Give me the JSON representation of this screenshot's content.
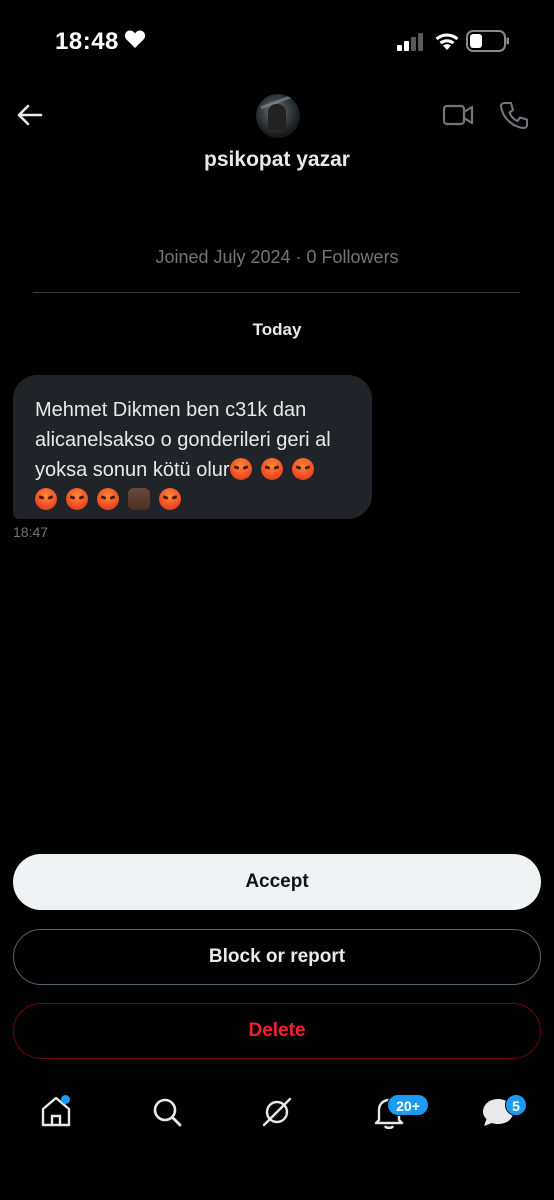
{
  "status_bar": {
    "time": "18:48"
  },
  "conversation": {
    "user_name": "psikopat yazar",
    "profile_meta": "Joined July 2024 · 0 Followers",
    "date_label": "Today",
    "message": {
      "text": "Mehmet Dikmen ben c31k dan alicanelsakso o gonderileri geri al yoksa sonun kötü olur",
      "emojis": [
        "angry-face",
        "angry-face",
        "angry-face",
        "angry-face",
        "angry-face",
        "angry-face",
        "fist-icon",
        "angry-face"
      ],
      "time": "18:47"
    }
  },
  "actions": {
    "accept_label": "Accept",
    "block_label": "Block or report",
    "delete_label": "Delete",
    "delete_color": "#f4212e"
  },
  "tabbar": {
    "notifications_badge": "20+",
    "messages_badge": "5",
    "accent": "#1d9bf0"
  }
}
